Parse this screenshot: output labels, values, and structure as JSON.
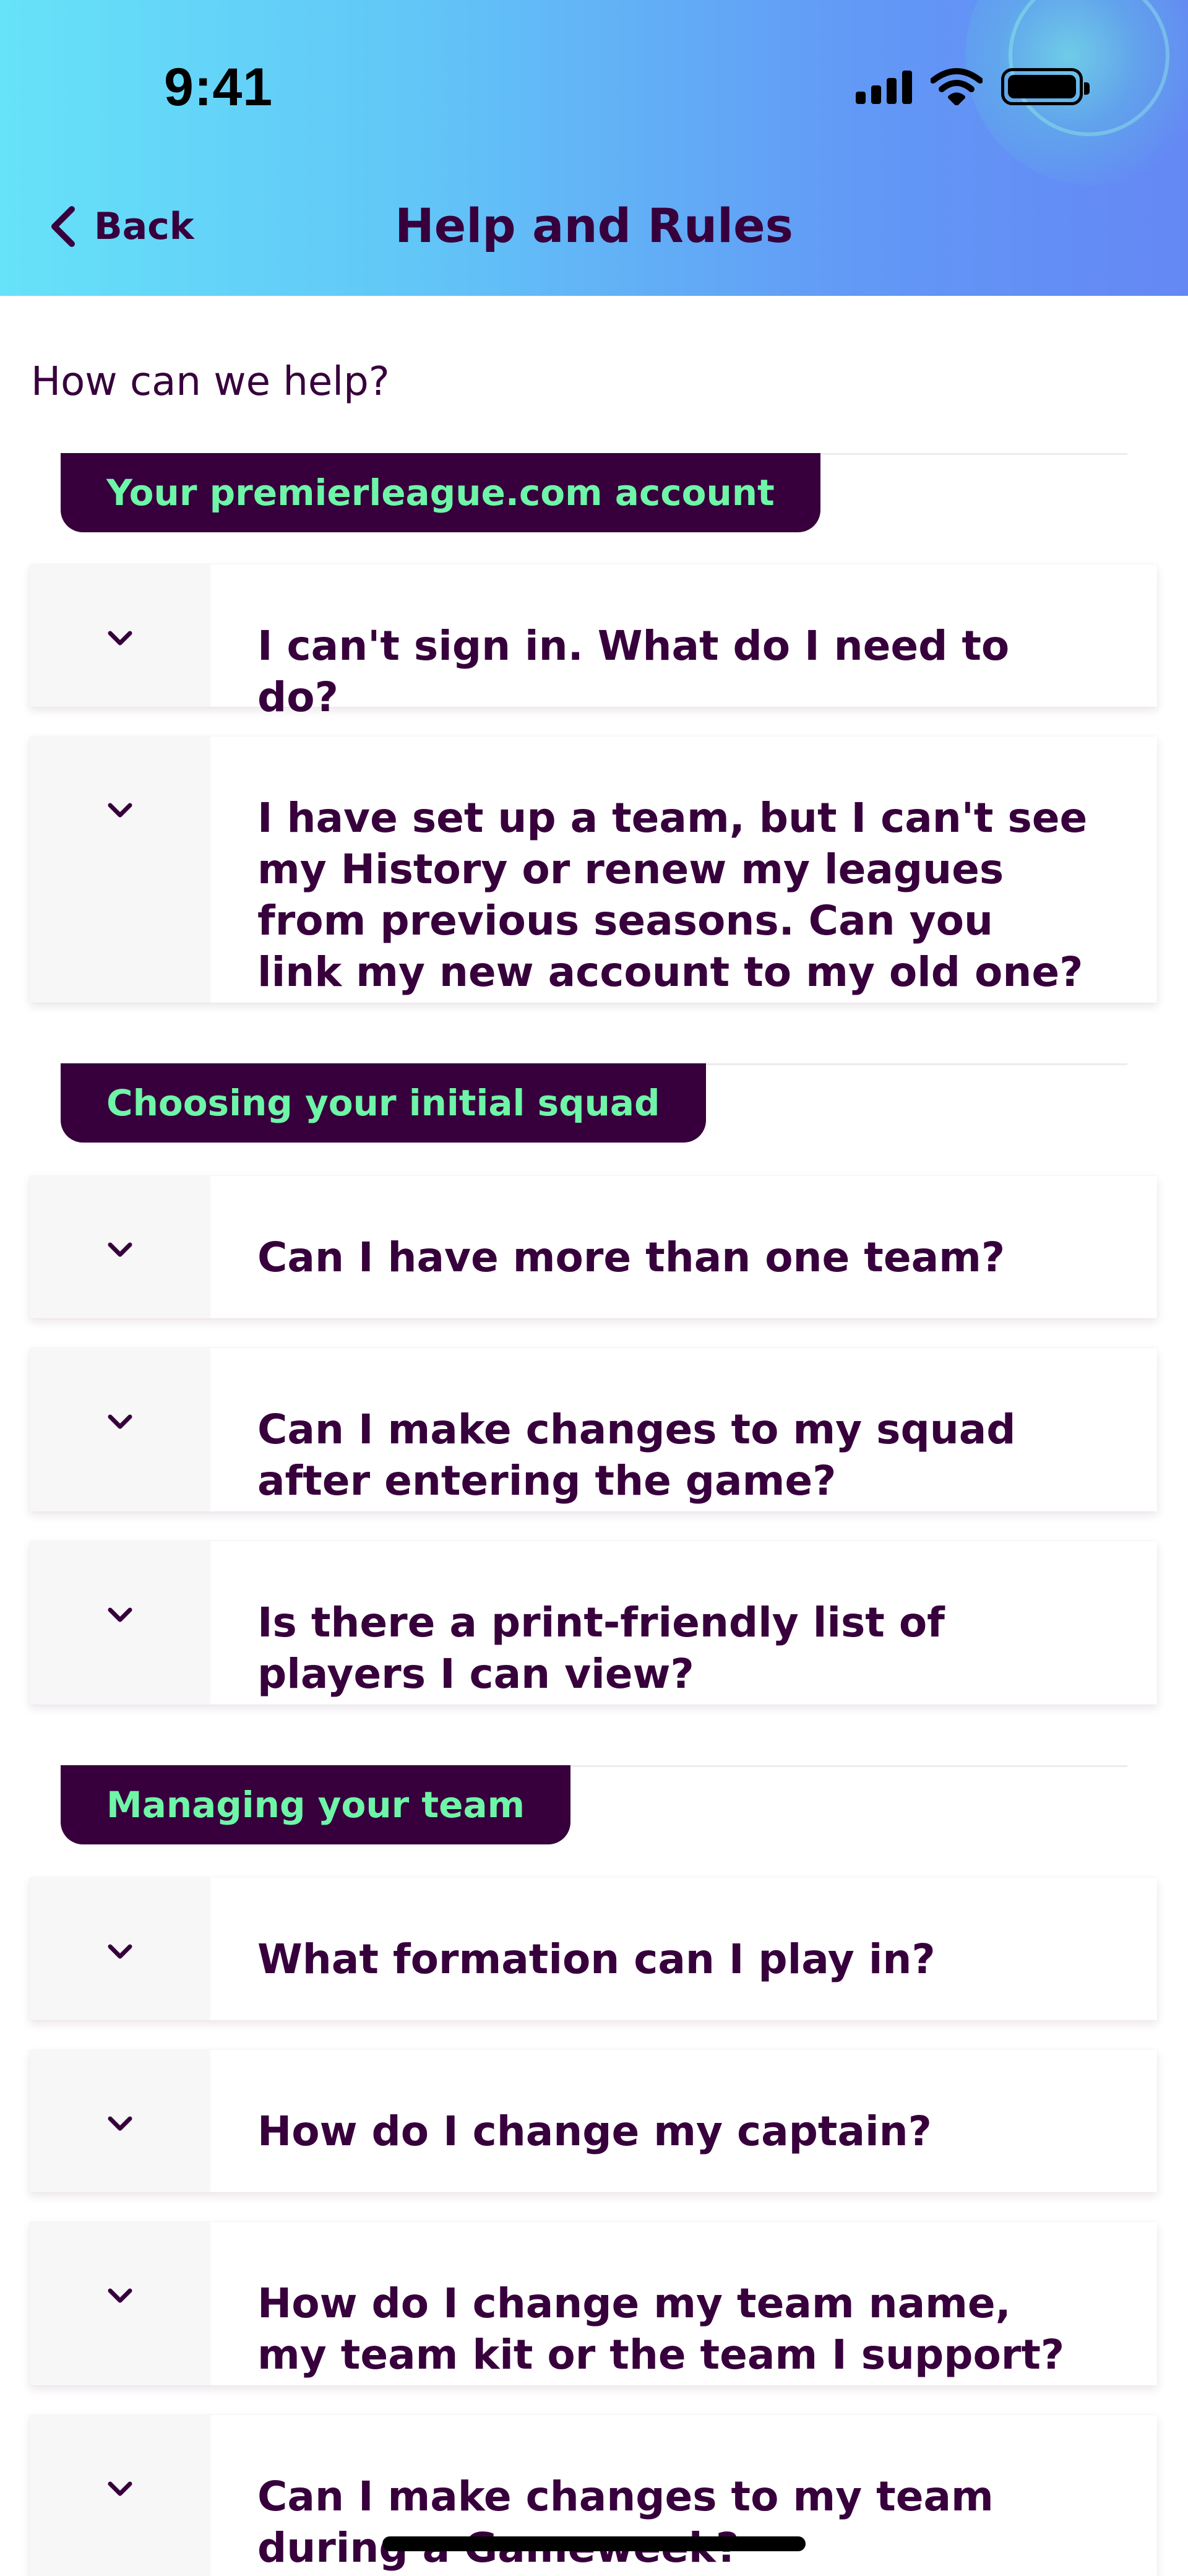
{
  "status_bar": {
    "time": "9:41",
    "icons": [
      "cellular-signal-icon",
      "wifi-icon",
      "battery-icon"
    ]
  },
  "header": {
    "back_label": "Back",
    "title": "Help and Rules"
  },
  "help_prompt": "How can we help?",
  "colors": {
    "brand_purple": "#37003c",
    "tab_text_green": "#6ef5a8",
    "header_gradient_start": "#66e2f9",
    "header_gradient_end": "#6487f4"
  },
  "sections": [
    {
      "title": "Your premierleague.com account",
      "questions": [
        "I can't sign in. What do I need to do?",
        "I have set up a team, but I can't see my History or renew my leagues from previous seasons. Can you link my new account to my old one?"
      ]
    },
    {
      "title": "Choosing your initial squad",
      "questions": [
        "Can I have more than one team?",
        "Can I make changes to my squad after entering the game?",
        "Is there a print-friendly list of players I can view?"
      ]
    },
    {
      "title": "Managing your team",
      "questions": [
        "What formation can I play in?",
        "How do I change my captain?",
        "How do I change my team name, my team kit or the team I support?",
        "Can I make changes to my team during a Gameweek?"
      ]
    }
  ]
}
